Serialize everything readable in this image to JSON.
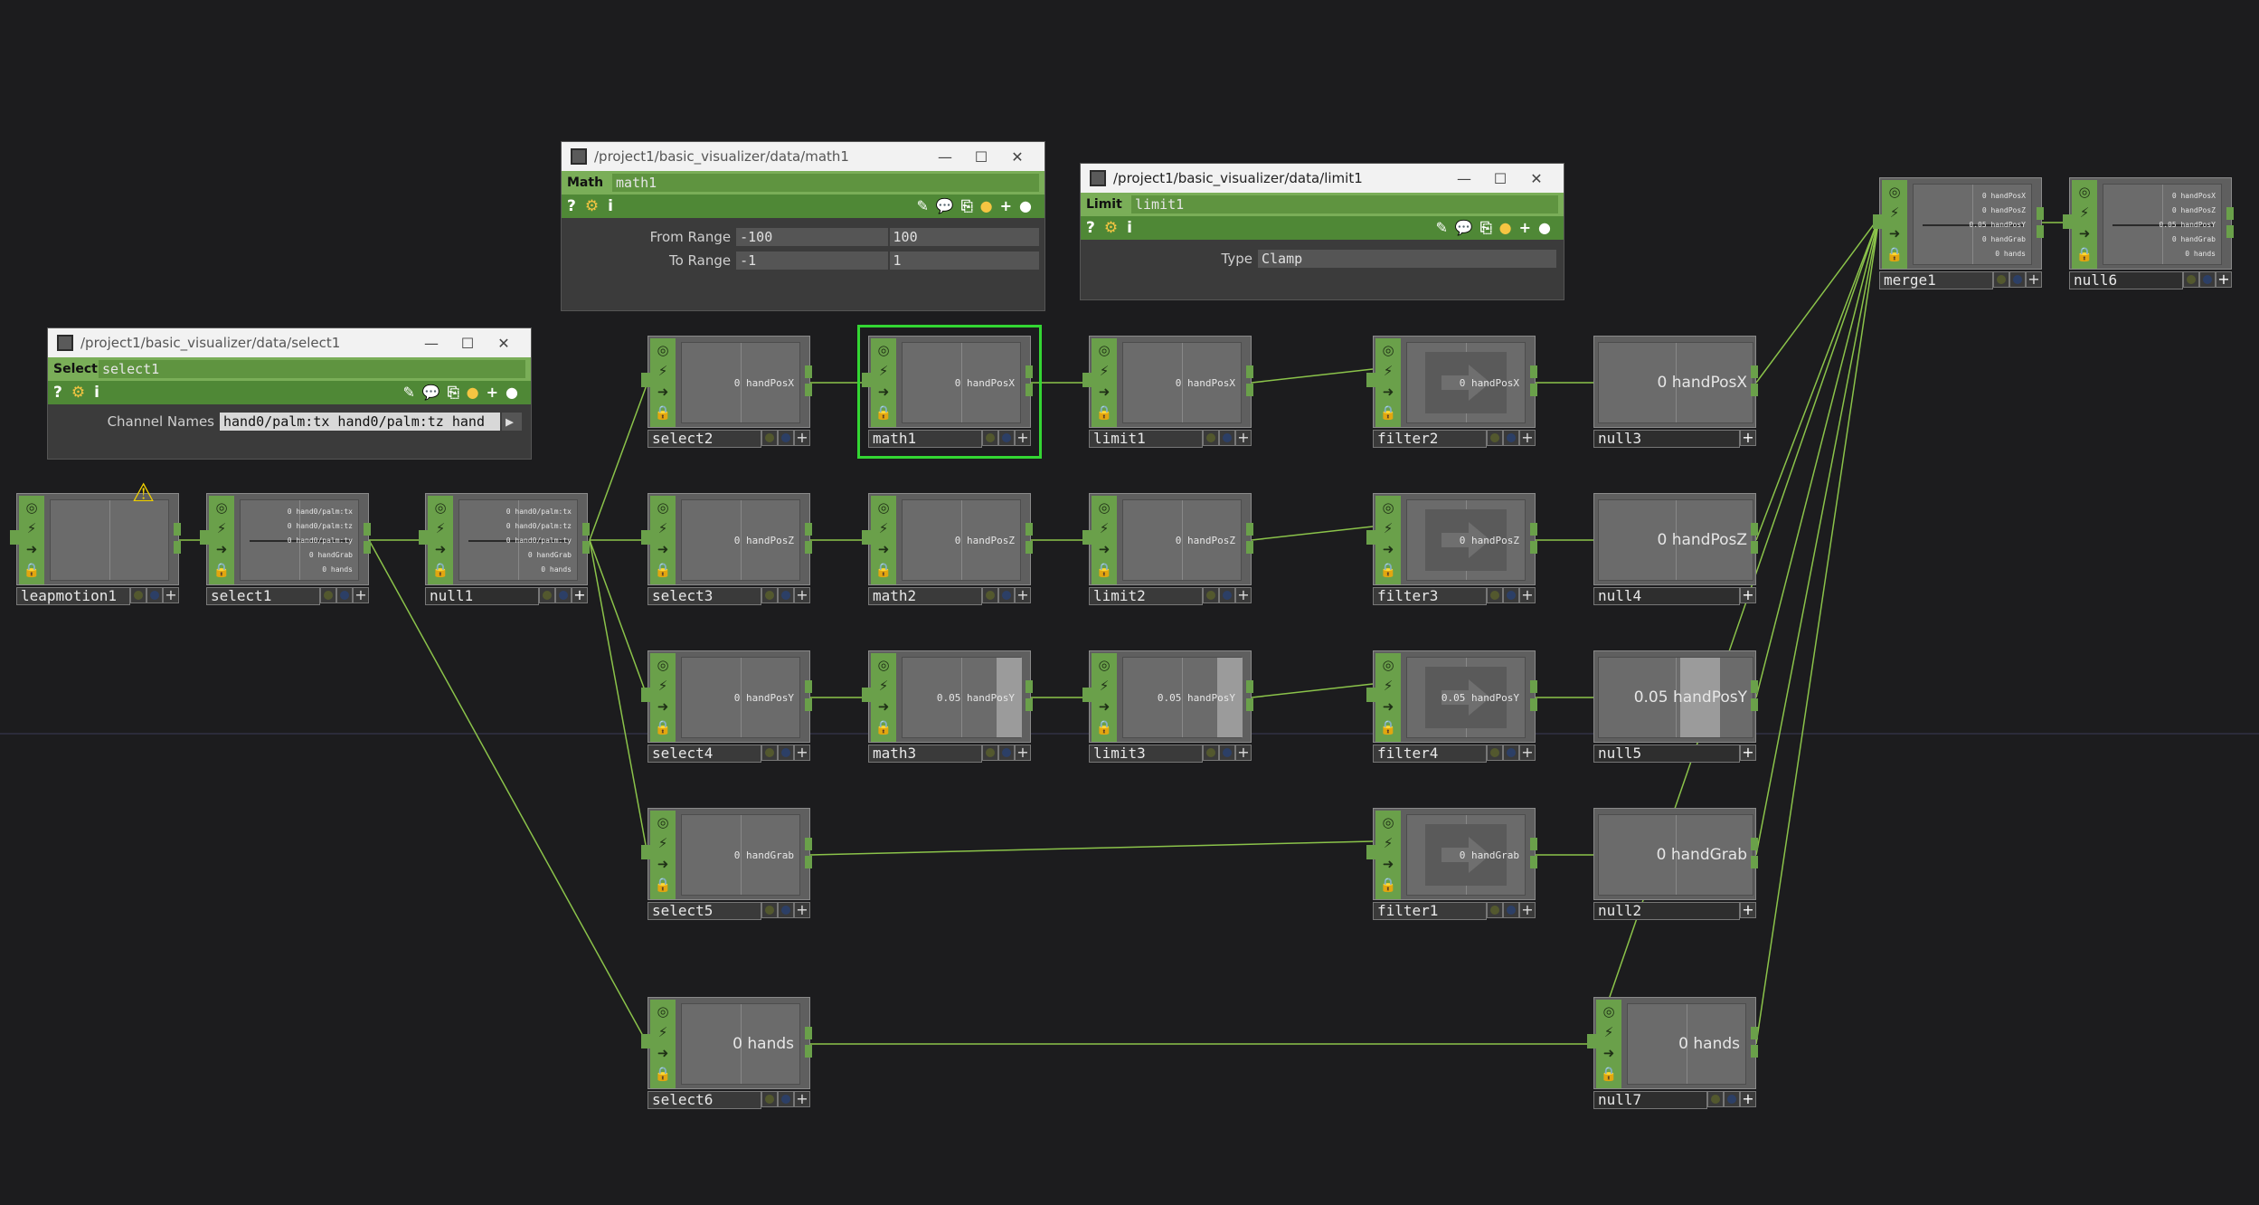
{
  "colors": {
    "wire": "#8bc34a",
    "flag": "#6aa04a",
    "selection": "#33d633",
    "background": "#1c1c1e"
  },
  "panels": {
    "select": {
      "path": "/project1/basic_visualizer/data/select1",
      "type": "Select",
      "name": "select1",
      "params": [
        {
          "label": "Channel Names",
          "value": "hand0/palm:tx hand0/palm:tz hand"
        }
      ]
    },
    "math": {
      "path": "/project1/basic_visualizer/data/math1",
      "type": "Math",
      "name": "math1",
      "params": [
        {
          "label": "From Range",
          "v1": "-100",
          "v2": "100"
        },
        {
          "label": "To Range",
          "v1": "-1",
          "v2": "1"
        }
      ]
    },
    "limit": {
      "path": "/project1/basic_visualizer/data/limit1",
      "type": "Limit",
      "name": "limit1",
      "params": [
        {
          "label": "Type",
          "value": "Clamp"
        }
      ]
    }
  },
  "window_buttons": {
    "min": "—",
    "max": "☐",
    "close": "✕"
  },
  "tool_icons": {
    "help": "?",
    "python": "python-help-icon",
    "info": "i",
    "edit": "✎",
    "comment": "comment-icon",
    "clone": "clone-icon",
    "script": "python-icon",
    "add": "+",
    "active": "●"
  },
  "nodes": [
    {
      "id": "leapmotion1",
      "label": "leapmotion1",
      "readout": [],
      "kind": "source"
    },
    {
      "id": "select1",
      "label": "select1",
      "readout": [
        "0 hand0/palm:tx",
        "0 hand0/palm:tz",
        "0 hand0/palm:ty",
        "0 handGrab",
        "0 hands"
      ]
    },
    {
      "id": "null1",
      "label": "null1",
      "readout": [
        "0 hand0/palm:tx",
        "0 hand0/palm:tz",
        "0 hand0/palm:ty",
        "0 handGrab",
        "0 hands"
      ]
    },
    {
      "id": "select2",
      "label": "select2",
      "readout": [
        "0 handPosX"
      ]
    },
    {
      "id": "select3",
      "label": "select3",
      "readout": [
        "0 handPosZ"
      ]
    },
    {
      "id": "select4",
      "label": "select4",
      "readout": [
        "0 handPosY"
      ]
    },
    {
      "id": "select5",
      "label": "select5",
      "readout": [
        "0 handGrab"
      ]
    },
    {
      "id": "select6",
      "label": "select6",
      "readout": [
        "0 hands"
      ],
      "big": true
    },
    {
      "id": "math1",
      "label": "math1",
      "readout": [
        "0 handPosX"
      ]
    },
    {
      "id": "math2",
      "label": "math2",
      "readout": [
        "0 handPosZ"
      ]
    },
    {
      "id": "math3",
      "label": "math3",
      "readout": [
        "0.05 handPosY"
      ]
    },
    {
      "id": "limit1",
      "label": "limit1",
      "readout": [
        "0 handPosX"
      ]
    },
    {
      "id": "limit2",
      "label": "limit2",
      "readout": [
        "0 handPosZ"
      ]
    },
    {
      "id": "limit3",
      "label": "limit3",
      "readout": [
        "0.05 handPosY"
      ]
    },
    {
      "id": "filter2",
      "label": "filter2",
      "readout": [
        "0 handPosX"
      ]
    },
    {
      "id": "filter3",
      "label": "filter3",
      "readout": [
        "0 handPosZ"
      ]
    },
    {
      "id": "filter4",
      "label": "filter4",
      "readout": [
        "0.05 handPosY"
      ]
    },
    {
      "id": "filter1",
      "label": "filter1",
      "readout": [
        "0 handGrab"
      ]
    },
    {
      "id": "null3",
      "label": "null3",
      "readout": [
        "0 handPosX"
      ]
    },
    {
      "id": "null4",
      "label": "null4",
      "readout": [
        "0 handPosZ"
      ]
    },
    {
      "id": "null5",
      "label": "null5",
      "readout": [
        "0.05 handPosY"
      ]
    },
    {
      "id": "null2",
      "label": "null2",
      "readout": [
        "0 handGrab"
      ]
    },
    {
      "id": "null7",
      "label": "null7",
      "readout": [
        "0 hands"
      ]
    },
    {
      "id": "merge1",
      "label": "merge1",
      "readout": [
        "0 handPosX",
        "0 handPosZ",
        "0.05 handPosY",
        "0 handGrab",
        "0 hands"
      ]
    },
    {
      "id": "null6",
      "label": "null6",
      "readout": [
        "0 handPosX",
        "0 handPosZ",
        "0.05 handPosY",
        "0 handGrab",
        "0 hands"
      ]
    }
  ],
  "selected_node": "math1",
  "warning_node": "leapmotion1"
}
